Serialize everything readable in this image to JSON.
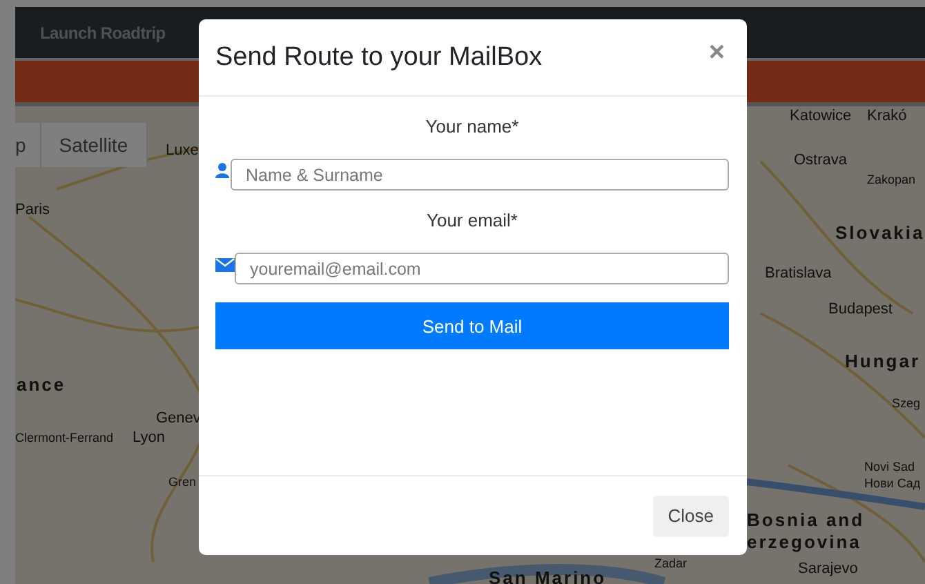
{
  "navbar": {
    "brand": "Launch Roadtrip"
  },
  "map": {
    "type_controls": [
      {
        "label": "p",
        "selected": false
      },
      {
        "label": "Satellite",
        "selected": false
      }
    ],
    "labels": [
      {
        "text": "Luxe",
        "kind": "town"
      },
      {
        "text": "Paris",
        "kind": "city"
      },
      {
        "text": "ance",
        "kind": "country"
      },
      {
        "text": "Genev",
        "kind": "town"
      },
      {
        "text": "Clermont-Ferrand",
        "kind": "small"
      },
      {
        "text": "Lyon",
        "kind": "city"
      },
      {
        "text": "Gren",
        "kind": "small"
      },
      {
        "text": "Katowice",
        "kind": "town"
      },
      {
        "text": "Krakó",
        "kind": "town"
      },
      {
        "text": "Ostrava",
        "kind": "town"
      },
      {
        "text": "Zakopan",
        "kind": "small"
      },
      {
        "text": "Slovakia",
        "kind": "country"
      },
      {
        "text": "Bratislava",
        "kind": "city"
      },
      {
        "text": "Budapest",
        "kind": "city"
      },
      {
        "text": "Hungar",
        "kind": "country"
      },
      {
        "text": "Szeg",
        "kind": "small"
      },
      {
        "text": "Novi Sad",
        "kind": "small"
      },
      {
        "text": "Нови Сад",
        "kind": "small"
      },
      {
        "text": "Bosnia and",
        "kind": "country"
      },
      {
        "text": "erzegovina",
        "kind": "country"
      },
      {
        "text": "Sarajevo",
        "kind": "town"
      },
      {
        "text": "Zadar",
        "kind": "small"
      },
      {
        "text": "San Marino",
        "kind": "country"
      }
    ]
  },
  "modal": {
    "title": "Send Route to your MailBox",
    "close_icon": "×",
    "fields": [
      {
        "label": "Your name*",
        "placeholder": "Name & Surname",
        "kind": "person"
      },
      {
        "label": "Your email*",
        "placeholder": "youremail@email.com",
        "kind": "email"
      }
    ],
    "submit": "Send to Mail",
    "footer_button": "Close"
  }
}
